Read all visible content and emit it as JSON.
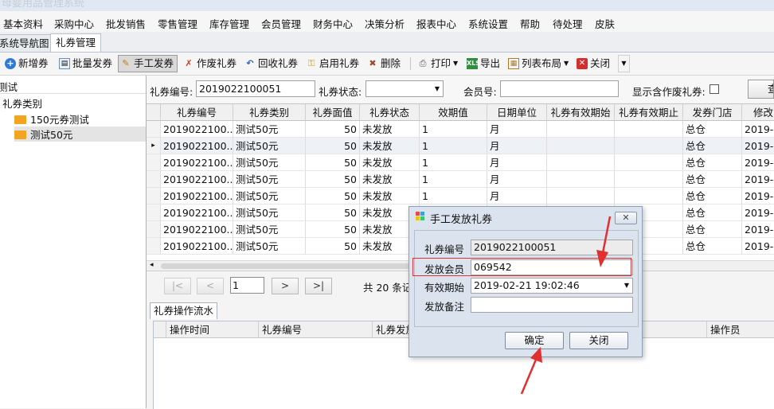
{
  "window": {
    "title": "母婴用品管理系统"
  },
  "menu": [
    "基本资料",
    "采购中心",
    "批发销售",
    "零售管理",
    "库存管理",
    "会员管理",
    "财务中心",
    "决策分析",
    "报表中心",
    "系统设置",
    "帮助",
    "待处理",
    "皮肤"
  ],
  "tabs": [
    {
      "label": "系统导航图",
      "active": false
    },
    {
      "label": "礼券管理",
      "active": true
    }
  ],
  "toolbar": {
    "add": "新增券",
    "batch": "批量发券",
    "manual": "手工发券",
    "void": "作废礼券",
    "recall": "回收礼券",
    "enable": "启用礼券",
    "delete": "删除",
    "print": "打印",
    "export": "导出",
    "layout": "列表布局",
    "close": "关闭"
  },
  "tree": {
    "root": "测试",
    "category": "礼券类别",
    "items": [
      "150元券测试",
      "测试50元"
    ]
  },
  "filter": {
    "code_label": "礼券编号:",
    "code_value": "2019022100051",
    "status_label": "礼券状态:",
    "status_value": "",
    "member_label": "会员号:",
    "member_value": "",
    "show_void_label": "显示含作废礼券:",
    "search_label": "查"
  },
  "grid": {
    "headers": [
      "礼券编号",
      "礼券类别",
      "礼券面值",
      "礼券状态",
      "效期值",
      "日期单位",
      "礼券有效期始",
      "礼券有效期止",
      "发券门店",
      "修改"
    ],
    "rows": [
      [
        "2019022100...",
        "测试50元",
        "50",
        "未发放",
        "1",
        "月",
        "",
        "",
        "总仓",
        "2019-0"
      ],
      [
        "2019022100...",
        "测试50元",
        "50",
        "未发放",
        "1",
        "月",
        "",
        "",
        "总仓",
        "2019-0"
      ],
      [
        "2019022100...",
        "测试50元",
        "50",
        "未发放",
        "1",
        "月",
        "",
        "",
        "总仓",
        "2019-0"
      ],
      [
        "2019022100...",
        "测试50元",
        "50",
        "未发放",
        "1",
        "月",
        "",
        "",
        "总仓",
        "2019-0"
      ],
      [
        "2019022100...",
        "测试50元",
        "50",
        "未发放",
        "1",
        "月",
        "",
        "",
        "总仓",
        "2019-0"
      ],
      [
        "2019022100...",
        "测试50元",
        "50",
        "未发放",
        "",
        "",
        "",
        "",
        "总仓",
        "2019-0"
      ],
      [
        "2019022100...",
        "测试50元",
        "50",
        "未发放",
        "",
        "",
        "",
        "",
        "总仓",
        "2019-0"
      ],
      [
        "2019022100...",
        "测试50元",
        "50",
        "未发放",
        "",
        "",
        "",
        "",
        "总仓",
        "2019-0"
      ]
    ],
    "selected_row_marker": "▸"
  },
  "pager": {
    "first": "|<",
    "prev": "<",
    "page": "1",
    "next": ">",
    "last": ">|",
    "total": "共 20 条记"
  },
  "log": {
    "tab": "礼券操作流水",
    "headers": [
      "操作时间",
      "礼券编号",
      "礼券发放",
      "操作员"
    ]
  },
  "dialog": {
    "title": "手工发放礼券",
    "code_label": "礼券编号",
    "code_value": "2019022100051",
    "member_label": "发放会员",
    "member_value": "069542",
    "start_label": "有效期始",
    "start_value": "2019-02-21 19:02:46",
    "note_label": "发放备注",
    "note_value": "",
    "ok": "确定",
    "cancel": "关闭",
    "close_glyph": "✕"
  },
  "annotation_color": "#e03030"
}
